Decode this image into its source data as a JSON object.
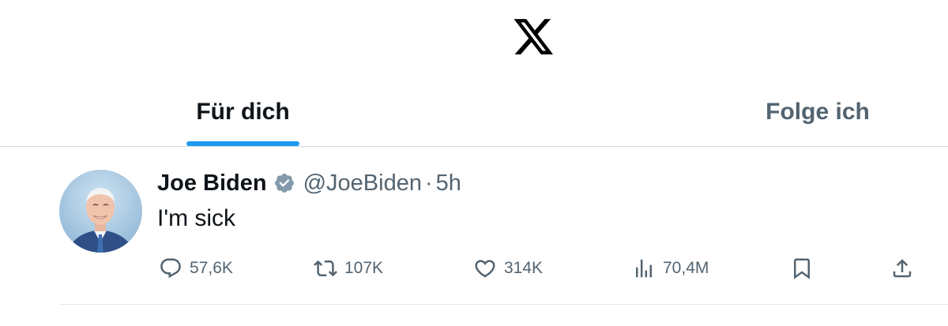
{
  "header": {
    "logo_icon": "x-logo-icon"
  },
  "tabs": [
    {
      "label": "Für dich",
      "active": true
    },
    {
      "label": "Folge ich",
      "active": false
    }
  ],
  "colors": {
    "accent": "#1d9bf0",
    "text_primary": "#0f1419",
    "text_secondary": "#536471",
    "divider": "#cfd9de",
    "verified_badge": "#829aab"
  },
  "tweet": {
    "author_name": "Joe Biden",
    "verified_icon": "verified-badge-icon",
    "handle": "@JoeBiden",
    "separator": "·",
    "time": "5h",
    "text": "I'm sick",
    "actions": {
      "reply": {
        "icon": "reply-icon",
        "count": "57,6K"
      },
      "retweet": {
        "icon": "retweet-icon",
        "count": "107K"
      },
      "like": {
        "icon": "heart-icon",
        "count": "314K"
      },
      "views": {
        "icon": "views-icon",
        "count": "70,4M"
      },
      "bookmark": {
        "icon": "bookmark-icon"
      },
      "share": {
        "icon": "share-icon"
      }
    }
  }
}
